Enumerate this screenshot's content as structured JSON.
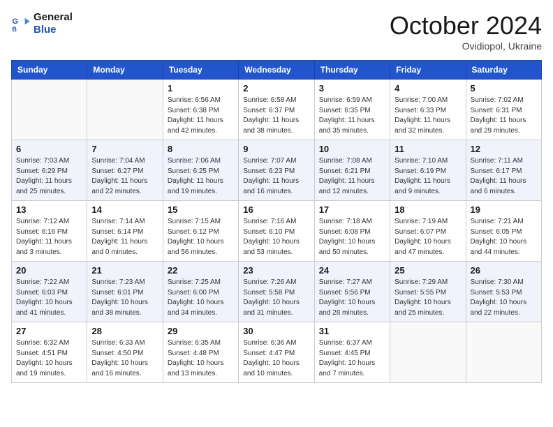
{
  "header": {
    "logo_line1": "General",
    "logo_line2": "Blue",
    "month": "October 2024",
    "location": "Ovidiopol, Ukraine"
  },
  "weekdays": [
    "Sunday",
    "Monday",
    "Tuesday",
    "Wednesday",
    "Thursday",
    "Friday",
    "Saturday"
  ],
  "weeks": [
    [
      {
        "day": "",
        "info": ""
      },
      {
        "day": "",
        "info": ""
      },
      {
        "day": "1",
        "info": "Sunrise: 6:56 AM\nSunset: 6:38 PM\nDaylight: 11 hours and 42 minutes."
      },
      {
        "day": "2",
        "info": "Sunrise: 6:58 AM\nSunset: 6:37 PM\nDaylight: 11 hours and 38 minutes."
      },
      {
        "day": "3",
        "info": "Sunrise: 6:59 AM\nSunset: 6:35 PM\nDaylight: 11 hours and 35 minutes."
      },
      {
        "day": "4",
        "info": "Sunrise: 7:00 AM\nSunset: 6:33 PM\nDaylight: 11 hours and 32 minutes."
      },
      {
        "day": "5",
        "info": "Sunrise: 7:02 AM\nSunset: 6:31 PM\nDaylight: 11 hours and 29 minutes."
      }
    ],
    [
      {
        "day": "6",
        "info": "Sunrise: 7:03 AM\nSunset: 6:29 PM\nDaylight: 11 hours and 25 minutes."
      },
      {
        "day": "7",
        "info": "Sunrise: 7:04 AM\nSunset: 6:27 PM\nDaylight: 11 hours and 22 minutes."
      },
      {
        "day": "8",
        "info": "Sunrise: 7:06 AM\nSunset: 6:25 PM\nDaylight: 11 hours and 19 minutes."
      },
      {
        "day": "9",
        "info": "Sunrise: 7:07 AM\nSunset: 6:23 PM\nDaylight: 11 hours and 16 minutes."
      },
      {
        "day": "10",
        "info": "Sunrise: 7:08 AM\nSunset: 6:21 PM\nDaylight: 11 hours and 12 minutes."
      },
      {
        "day": "11",
        "info": "Sunrise: 7:10 AM\nSunset: 6:19 PM\nDaylight: 11 hours and 9 minutes."
      },
      {
        "day": "12",
        "info": "Sunrise: 7:11 AM\nSunset: 6:17 PM\nDaylight: 11 hours and 6 minutes."
      }
    ],
    [
      {
        "day": "13",
        "info": "Sunrise: 7:12 AM\nSunset: 6:16 PM\nDaylight: 11 hours and 3 minutes."
      },
      {
        "day": "14",
        "info": "Sunrise: 7:14 AM\nSunset: 6:14 PM\nDaylight: 11 hours and 0 minutes."
      },
      {
        "day": "15",
        "info": "Sunrise: 7:15 AM\nSunset: 6:12 PM\nDaylight: 10 hours and 56 minutes."
      },
      {
        "day": "16",
        "info": "Sunrise: 7:16 AM\nSunset: 6:10 PM\nDaylight: 10 hours and 53 minutes."
      },
      {
        "day": "17",
        "info": "Sunrise: 7:18 AM\nSunset: 6:08 PM\nDaylight: 10 hours and 50 minutes."
      },
      {
        "day": "18",
        "info": "Sunrise: 7:19 AM\nSunset: 6:07 PM\nDaylight: 10 hours and 47 minutes."
      },
      {
        "day": "19",
        "info": "Sunrise: 7:21 AM\nSunset: 6:05 PM\nDaylight: 10 hours and 44 minutes."
      }
    ],
    [
      {
        "day": "20",
        "info": "Sunrise: 7:22 AM\nSunset: 6:03 PM\nDaylight: 10 hours and 41 minutes."
      },
      {
        "day": "21",
        "info": "Sunrise: 7:23 AM\nSunset: 6:01 PM\nDaylight: 10 hours and 38 minutes."
      },
      {
        "day": "22",
        "info": "Sunrise: 7:25 AM\nSunset: 6:00 PM\nDaylight: 10 hours and 34 minutes."
      },
      {
        "day": "23",
        "info": "Sunrise: 7:26 AM\nSunset: 5:58 PM\nDaylight: 10 hours and 31 minutes."
      },
      {
        "day": "24",
        "info": "Sunrise: 7:27 AM\nSunset: 5:56 PM\nDaylight: 10 hours and 28 minutes."
      },
      {
        "day": "25",
        "info": "Sunrise: 7:29 AM\nSunset: 5:55 PM\nDaylight: 10 hours and 25 minutes."
      },
      {
        "day": "26",
        "info": "Sunrise: 7:30 AM\nSunset: 5:53 PM\nDaylight: 10 hours and 22 minutes."
      }
    ],
    [
      {
        "day": "27",
        "info": "Sunrise: 6:32 AM\nSunset: 4:51 PM\nDaylight: 10 hours and 19 minutes."
      },
      {
        "day": "28",
        "info": "Sunrise: 6:33 AM\nSunset: 4:50 PM\nDaylight: 10 hours and 16 minutes."
      },
      {
        "day": "29",
        "info": "Sunrise: 6:35 AM\nSunset: 4:48 PM\nDaylight: 10 hours and 13 minutes."
      },
      {
        "day": "30",
        "info": "Sunrise: 6:36 AM\nSunset: 4:47 PM\nDaylight: 10 hours and 10 minutes."
      },
      {
        "day": "31",
        "info": "Sunrise: 6:37 AM\nSunset: 4:45 PM\nDaylight: 10 hours and 7 minutes."
      },
      {
        "day": "",
        "info": ""
      },
      {
        "day": "",
        "info": ""
      }
    ]
  ]
}
